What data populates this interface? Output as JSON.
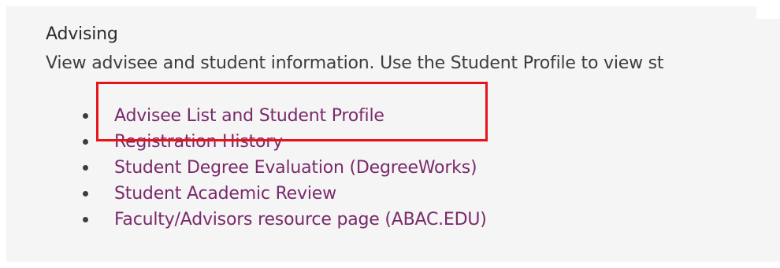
{
  "advising": {
    "heading": "Advising",
    "description": "View advisee and student information. Use the Student Profile to view st",
    "links": [
      {
        "label": "Advisee List and Student Profile"
      },
      {
        "label": "Registration History"
      },
      {
        "label": "Student Degree Evaluation (DegreeWorks)"
      },
      {
        "label": "Student Academic Review"
      },
      {
        "label": "Faculty/Advisors resource page (ABAC.EDU)"
      }
    ]
  },
  "colors": {
    "link": "#7a2a6b",
    "highlight_border": "#e8141b",
    "panel_background": "#f5f5f5"
  }
}
